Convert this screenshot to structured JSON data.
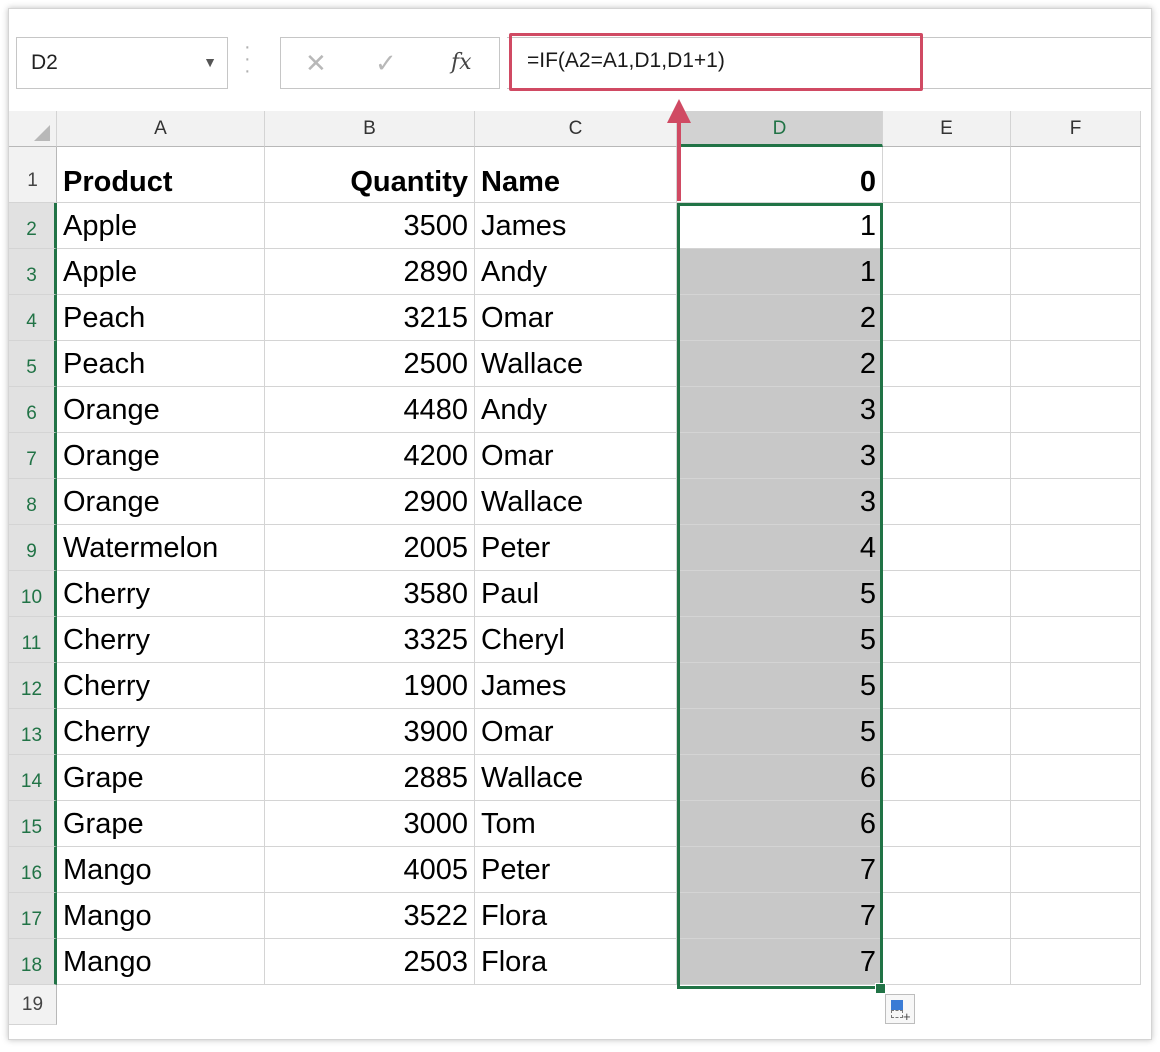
{
  "name_box": {
    "value": "D2",
    "dropdown_icon": "chevron-down-icon"
  },
  "formula_bar": {
    "cancel_icon": "close-icon",
    "enter_icon": "check-icon",
    "fx_label": "fx",
    "formula": "=IF(A2=A1,D1,D1+1)"
  },
  "columns": [
    "A",
    "B",
    "C",
    "D",
    "E",
    "F"
  ],
  "row_numbers": [
    "1",
    "2",
    "3",
    "4",
    "5",
    "6",
    "7",
    "8",
    "9",
    "10",
    "11",
    "12",
    "13",
    "14",
    "15",
    "16",
    "17",
    "18",
    "19"
  ],
  "header_row": {
    "A": "Product",
    "B": "Quantity",
    "C": "Name",
    "D": "0"
  },
  "rows": [
    {
      "A": "Apple",
      "B": "3500",
      "C": "James",
      "D": "1"
    },
    {
      "A": "Apple",
      "B": "2890",
      "C": "Andy",
      "D": "1"
    },
    {
      "A": "Peach",
      "B": "3215",
      "C": "Omar",
      "D": "2"
    },
    {
      "A": "Peach",
      "B": "2500",
      "C": "Wallace",
      "D": "2"
    },
    {
      "A": "Orange",
      "B": "4480",
      "C": "Andy",
      "D": "3"
    },
    {
      "A": "Orange",
      "B": "4200",
      "C": "Omar",
      "D": "3"
    },
    {
      "A": "Orange",
      "B": "2900",
      "C": "Wallace",
      "D": "3"
    },
    {
      "A": "Watermelon",
      "B": "2005",
      "C": "Peter",
      "D": "4"
    },
    {
      "A": "Cherry",
      "B": "3580",
      "C": "Paul",
      "D": "5"
    },
    {
      "A": "Cherry",
      "B": "3325",
      "C": "Cheryl",
      "D": "5"
    },
    {
      "A": "Cherry",
      "B": "1900",
      "C": "James",
      "D": "5"
    },
    {
      "A": "Cherry",
      "B": "3900",
      "C": "Omar",
      "D": "5"
    },
    {
      "A": "Grape",
      "B": "2885",
      "C": "Wallace",
      "D": "6"
    },
    {
      "A": "Grape",
      "B": "3000",
      "C": "Tom",
      "D": "6"
    },
    {
      "A": "Mango",
      "B": "4005",
      "C": "Peter",
      "D": "7"
    },
    {
      "A": "Mango",
      "B": "3522",
      "C": "Flora",
      "D": "7"
    },
    {
      "A": "Mango",
      "B": "2503",
      "C": "Flora",
      "D": "7"
    }
  ],
  "colors": {
    "selection": "#217346",
    "highlight": "#d04a63",
    "selected_fill": "#c8c8c8"
  }
}
